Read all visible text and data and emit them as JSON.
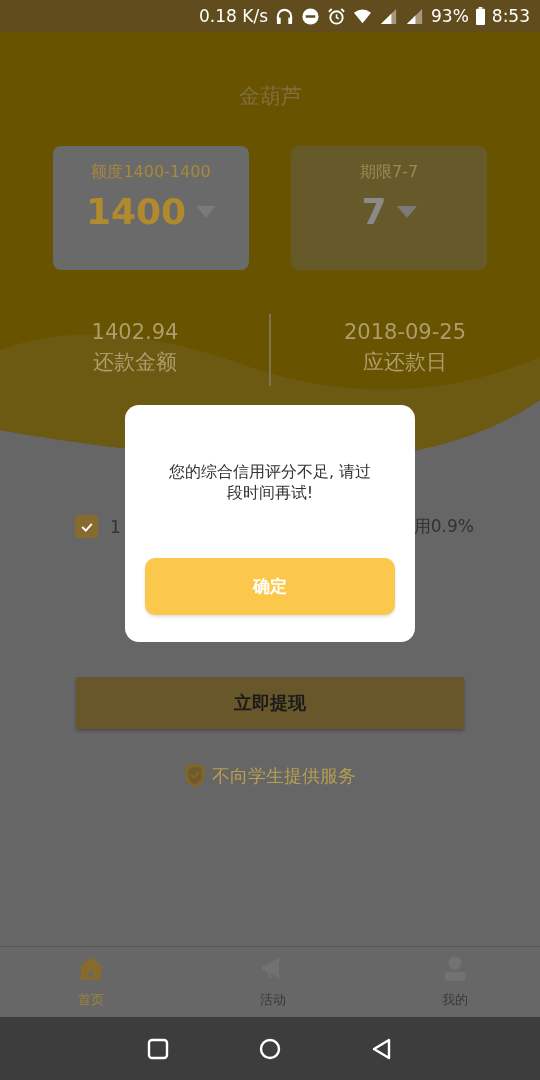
{
  "status_bar": {
    "net_speed": "0.18 K/s",
    "battery": "93%",
    "time": "8:53"
  },
  "header": {
    "title": "金葫芦"
  },
  "selectors": [
    {
      "label": "额度1400-1400",
      "value": "1400",
      "selected": true
    },
    {
      "label": "期限7-7",
      "value": "7",
      "selected": false
    }
  ],
  "summary": [
    {
      "value": "1402.94",
      "label": "还款金额"
    },
    {
      "value": "2018-09-25",
      "label": "应还款日"
    }
  ],
  "agreement": {
    "checked": true,
    "text_start": "1",
    "text_end": "用0.9%"
  },
  "submit_button": "立即提现",
  "notice": "不向学生提供服务",
  "tabs": [
    {
      "label": "首页",
      "selected": true
    },
    {
      "label": "活动",
      "selected": false
    },
    {
      "label": "我的",
      "selected": false
    }
  ],
  "dialog": {
    "message": "您的综合信用评分不足, 请过段时间再试!",
    "button": "确定"
  }
}
